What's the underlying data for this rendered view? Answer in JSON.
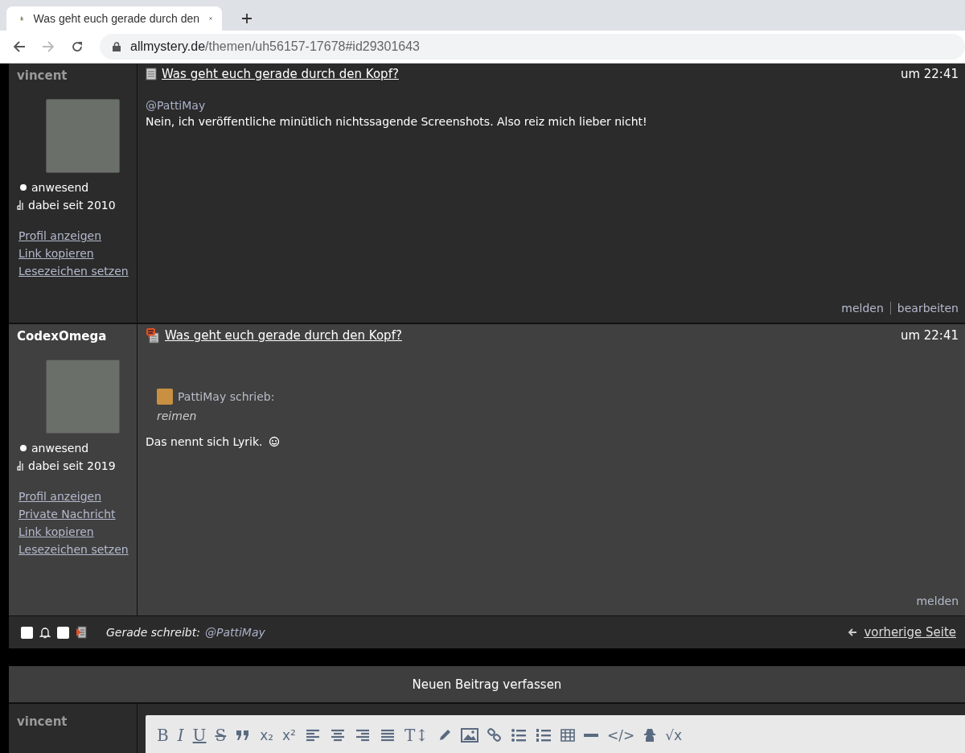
{
  "browser": {
    "tab_title": "Was geht euch gerade durch den",
    "url_domain": "allmystery.de",
    "url_path": "/themen/uh56157-17678#id29301643"
  },
  "posts": [
    {
      "author": "vincent",
      "status": "anwesend",
      "since": "dabei seit 2010",
      "links": [
        "Profil anzeigen",
        "Link kopieren",
        "Lesezeichen setzen"
      ],
      "new": false,
      "title": "Was geht euch gerade durch den Kopf?",
      "time": "um 22:41",
      "mention": "@PattiMay",
      "body": "Nein, ich veröffentliche minütlich nichtssagende Screenshots. Also reiz mich lieber nicht!",
      "smiley": false,
      "actions": [
        "melden",
        "bearbeiten"
      ]
    },
    {
      "author": "CodexOmega",
      "status": "anwesend",
      "since": "dabei seit 2019",
      "links": [
        "Profil anzeigen",
        "Private Nachricht",
        "Link kopieren",
        "Lesezeichen setzen"
      ],
      "new": true,
      "title": "Was geht euch gerade durch den Kopf?",
      "time": "um 22:41",
      "quote": {
        "author": "PattiMay schrieb:",
        "text": "reimen"
      },
      "body": "Das nennt sich Lyrik.",
      "smiley": true,
      "actions": [
        "melden"
      ]
    }
  ],
  "footer": {
    "subscribe_checked": false,
    "mark_checked": false,
    "typing_label": "Gerade schreibt:",
    "typing_user": "@PattiMay",
    "prev_link": "vorherige Seite"
  },
  "compose": {
    "title": "Neuen Beitrag verfassen",
    "user": "vincent",
    "toolbar": [
      {
        "kind": "bold",
        "label": "B"
      },
      {
        "kind": "italic",
        "label": "I"
      },
      {
        "kind": "underline",
        "label": "U"
      },
      {
        "kind": "strike",
        "label": "S"
      },
      {
        "kind": "quote"
      },
      {
        "kind": "sub",
        "label": "x₂"
      },
      {
        "kind": "sup",
        "label": "x²"
      },
      {
        "kind": "align-left"
      },
      {
        "kind": "align-center"
      },
      {
        "kind": "align-right"
      },
      {
        "kind": "justify"
      },
      {
        "kind": "text-size",
        "label": "T↕"
      },
      {
        "kind": "pencil"
      },
      {
        "kind": "image"
      },
      {
        "kind": "link"
      },
      {
        "kind": "bullets"
      },
      {
        "kind": "numbers"
      },
      {
        "kind": "table"
      },
      {
        "kind": "rule"
      },
      {
        "kind": "code",
        "label": "</>"
      },
      {
        "kind": "spy"
      },
      {
        "kind": "formula",
        "label": "√x"
      }
    ]
  }
}
